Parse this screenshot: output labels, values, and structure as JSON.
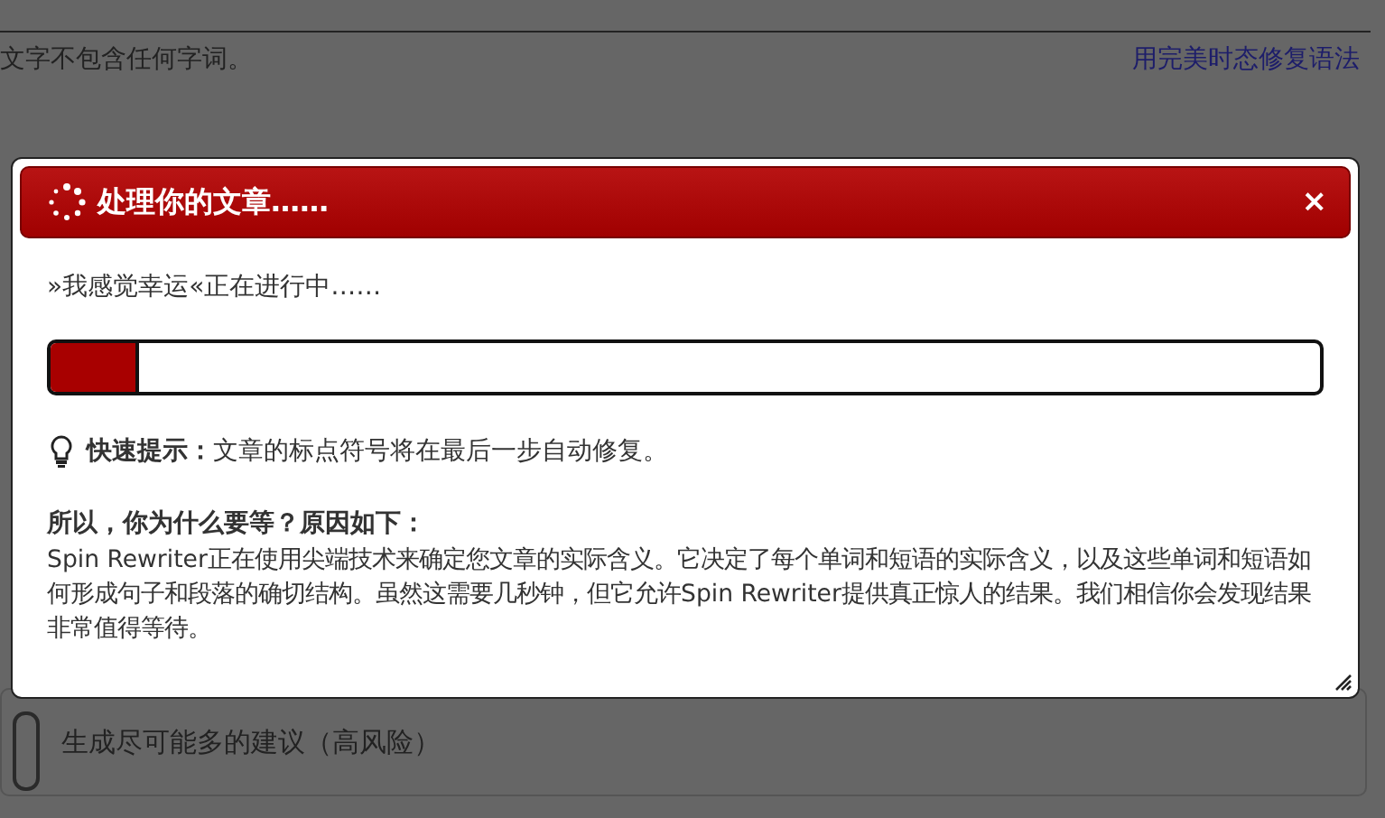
{
  "background": {
    "notice": "文字不包含任何字词。",
    "grammar_link": "用完美时态修复语法",
    "option": {
      "label": "生成尽可能多的建议（高风险）",
      "checked": false
    }
  },
  "dialog": {
    "title": "处理你的文章……",
    "close": "×",
    "status": "»我感觉幸运«正在进行中……",
    "progress": {
      "level": 0.07
    },
    "tip": {
      "label": "快速提示：",
      "text": "文章的标点符号将在最后一步自动修复。"
    },
    "reason_heading": "所以，你为什么要等？原因如下：",
    "reason_text": "Spin Rewriter正在使用尖端技术来确定您文章的实际含义。它决定了每个单词和短语的实际含义，以及这些单词和短语如何形成句子和段落的确切结构。虽然这需要几秒钟，但它允许Spin Rewriter提供真正惊人的结果。我们相信你会发现结果非常值得等待。"
  }
}
